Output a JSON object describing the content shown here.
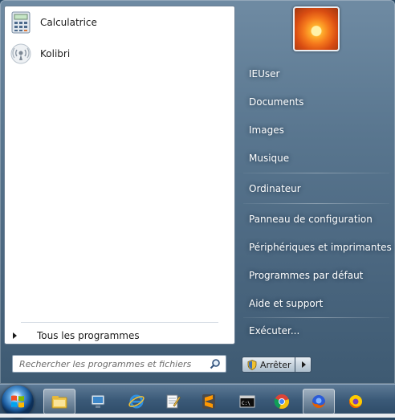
{
  "left_pane": {
    "pinned": [
      {
        "label": "Calculatrice",
        "icon": "calculator-icon"
      },
      {
        "label": "Kolibri",
        "icon": "kolibri-icon"
      }
    ],
    "all_programs_label": "Tous les programmes"
  },
  "search": {
    "placeholder": "Rechercher les programmes et fichiers"
  },
  "right_pane": {
    "items": [
      "IEUser",
      "Documents",
      "Images",
      "Musique",
      "Ordinateur",
      "Panneau de configuration",
      "Périphériques et imprimantes",
      "Programmes par défaut",
      "Aide et support",
      "Exécuter..."
    ],
    "shutdown_label": "Arrêter"
  },
  "taskbar": {
    "items": [
      {
        "icon": "file-explorer-icon",
        "active": true
      },
      {
        "icon": "network-icon",
        "active": false
      },
      {
        "icon": "internet-explorer-icon",
        "active": false
      },
      {
        "icon": "notepad-icon",
        "active": false
      },
      {
        "icon": "sublime-text-icon",
        "active": false
      },
      {
        "icon": "command-prompt-icon",
        "active": false
      },
      {
        "icon": "chrome-icon",
        "active": false
      },
      {
        "icon": "firefox-icon",
        "active": true
      },
      {
        "icon": "firefox-icon",
        "active": false
      }
    ]
  },
  "colors": {
    "menu_blue": "#59768f",
    "left_pane_bg": "#ffffff",
    "taskbar_blue": "#3b5a78"
  }
}
